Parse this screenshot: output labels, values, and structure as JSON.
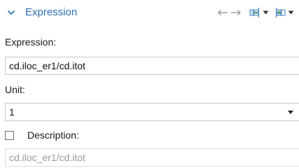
{
  "section": {
    "title": "Expression",
    "collapse_icon": "chevron-down-icon",
    "title_color": "#2a6fb0"
  },
  "toolbar": {
    "icons": [
      "arrow-left-icon",
      "arrow-right-icon",
      "insert-column-icon",
      "dropdown-icon",
      "insert-column-icon",
      "dropdown-icon"
    ]
  },
  "expression": {
    "label": "Expression:",
    "value": "cd.iloc_er1/cd.itot"
  },
  "unit": {
    "label": "Unit:",
    "selected": "1"
  },
  "description": {
    "label": "Description:",
    "checked": false,
    "placeholder": "cd.iloc_er1/cd.itot"
  }
}
